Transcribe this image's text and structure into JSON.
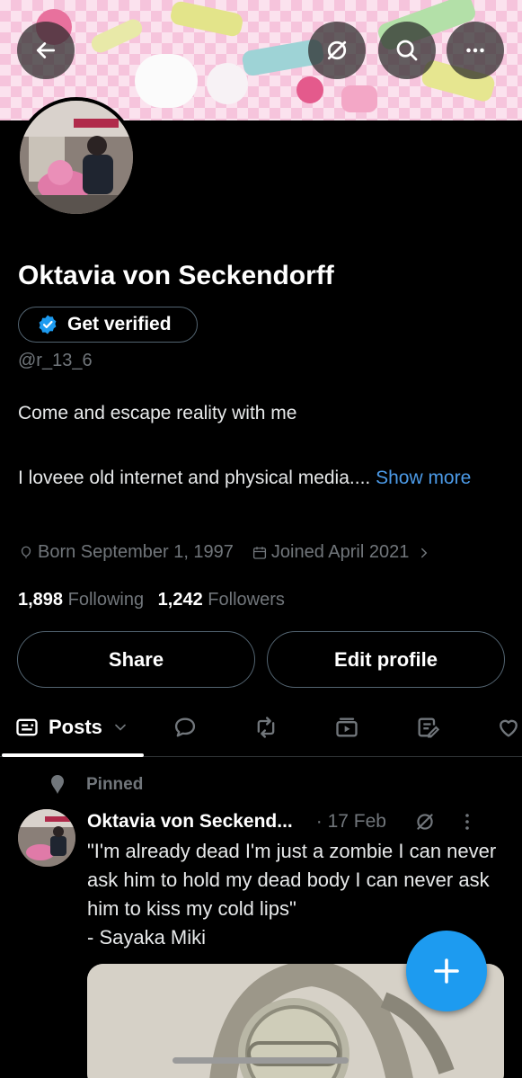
{
  "header": {
    "back_icon": "arrow-left-icon",
    "grok_icon": "slashed-circle-icon",
    "search_icon": "search-icon",
    "more_icon": "more-horizontal-icon"
  },
  "profile": {
    "name": "Oktavia von Seckendorff",
    "verify_label": "Get verified",
    "handle": "@r_13_6",
    "bio_line1": "Come and escape reality with me",
    "bio_line2": "I loveee old internet and physical media.... ",
    "bio_show_more": "Show more",
    "born": "Born September 1, 1997",
    "joined": "Joined April 2021",
    "following_count": "1,898",
    "following_label": "Following",
    "followers_count": "1,242",
    "followers_label": "Followers",
    "share_label": "Share",
    "edit_label": "Edit profile"
  },
  "tabs": {
    "posts_label": "Posts",
    "icons": [
      "reply-icon",
      "repost-icon",
      "video-icon",
      "article-icon",
      "like-icon"
    ]
  },
  "post": {
    "pinned_label": "Pinned",
    "author": "Oktavia von Seckend...",
    "date": "· 17 Feb",
    "text": "\"I'm already dead I'm just a zombie I can never ask him to hold my dead body I can never ask him to kiss my cold lips\"\n- Sayaka Miki"
  },
  "colors": {
    "accent": "#1d9bf0",
    "link": "#4c9be8",
    "muted": "#71767b",
    "border": "#536471"
  }
}
